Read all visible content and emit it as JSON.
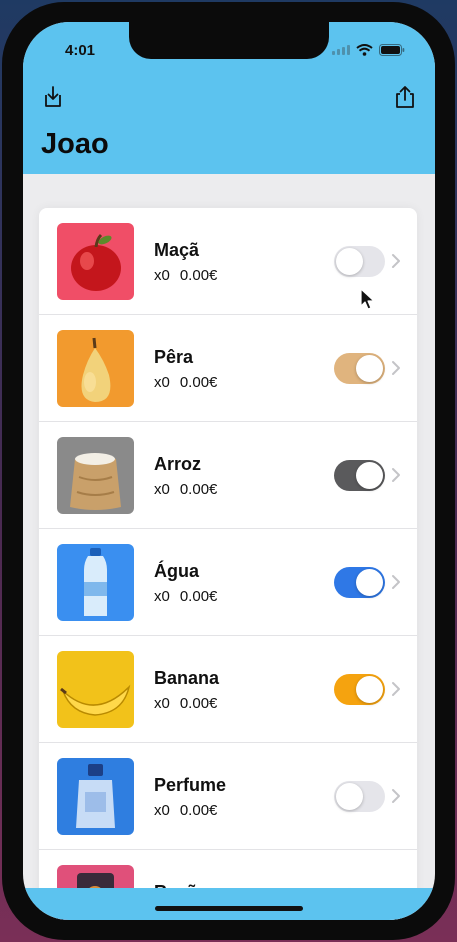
{
  "status_bar": {
    "time": "4:01"
  },
  "nav": {
    "title": "Joao",
    "left_icon": "download-tray-icon",
    "right_icon": "share-icon",
    "color": "#5cc3ef"
  },
  "items": [
    {
      "name": "Maçã",
      "qty": "x0",
      "price": "0.00€",
      "toggle_on": false,
      "toggle_color": "#e5e5ea",
      "image": "apple"
    },
    {
      "name": "Pêra",
      "qty": "x0",
      "price": "0.00€",
      "toggle_on": true,
      "toggle_color": "#e0b47e",
      "image": "pear"
    },
    {
      "name": "Arroz",
      "qty": "x0",
      "price": "0.00€",
      "toggle_on": true,
      "toggle_color": "#5a5a5c",
      "image": "rice-sack"
    },
    {
      "name": "Água",
      "qty": "x0",
      "price": "0.00€",
      "toggle_on": true,
      "toggle_color": "#2f78e6",
      "image": "water-bottle"
    },
    {
      "name": "Banana",
      "qty": "x0",
      "price": "0.00€",
      "toggle_on": true,
      "toggle_color": "#f5a30f",
      "image": "banana"
    },
    {
      "name": "Perfume",
      "qty": "x0",
      "price": "0.00€",
      "toggle_on": false,
      "toggle_color": "#e5e5ea",
      "image": "perfume"
    },
    {
      "name": "Ração",
      "qty": "",
      "price": "",
      "toggle_on": false,
      "toggle_color": "#e5e5ea",
      "image": "pet-food"
    }
  ]
}
